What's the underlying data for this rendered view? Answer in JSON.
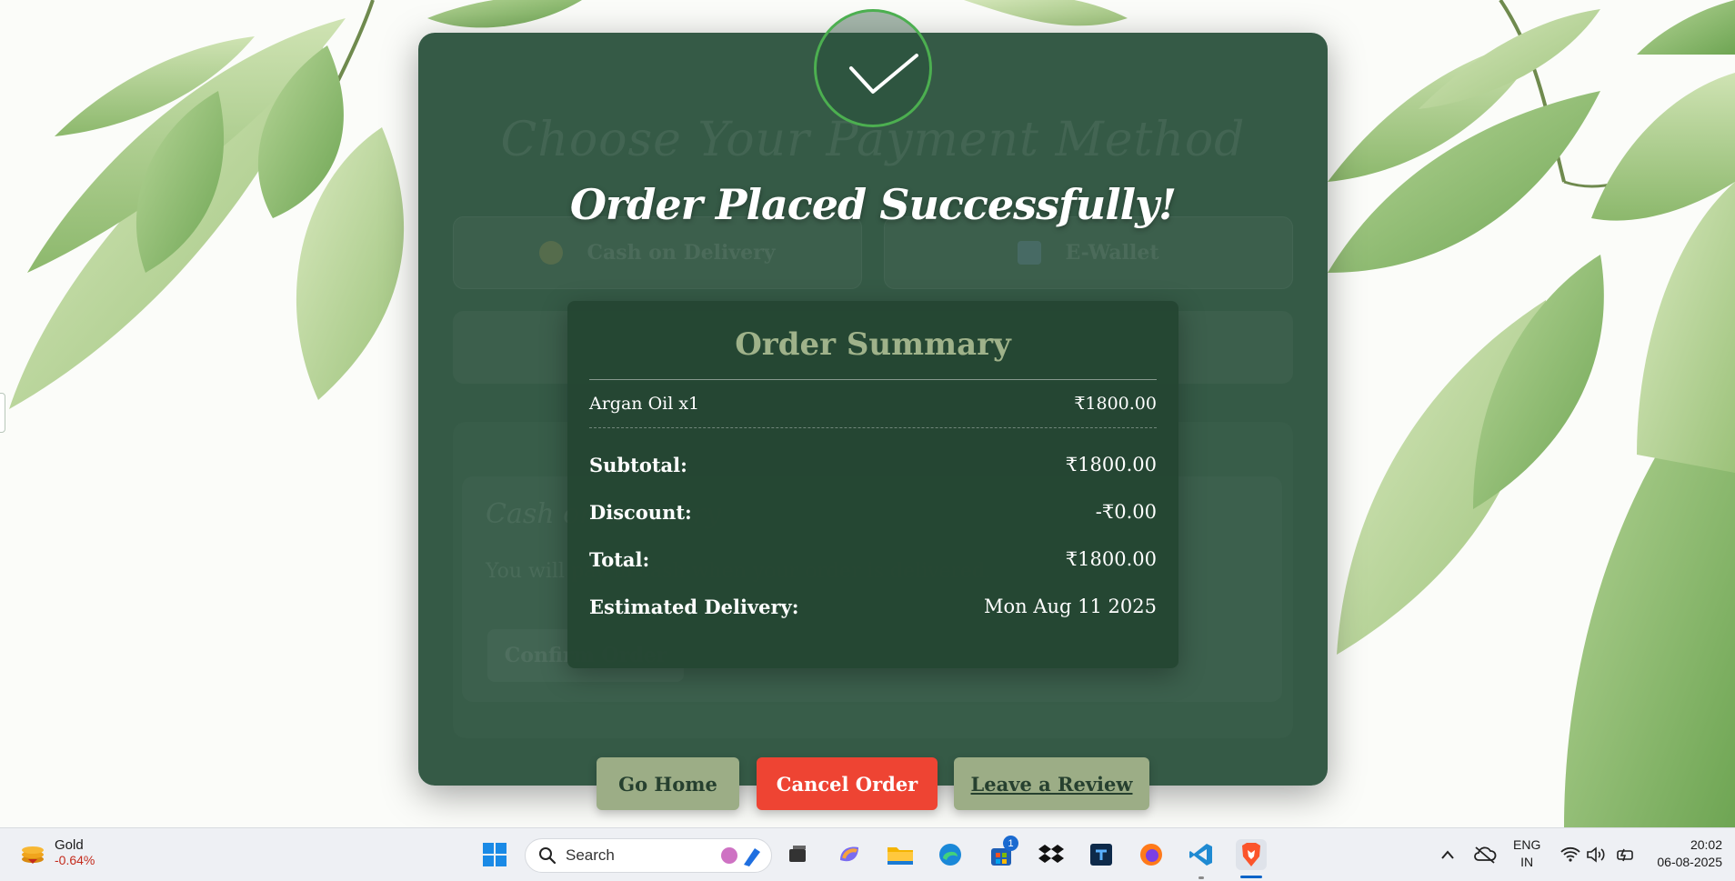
{
  "page": {
    "ghost_title": "Choose Your Payment Method",
    "payment_options": [
      "Cash on Delivery",
      "E-Wallet"
    ],
    "ghost_section_title": "Cash on Delivery",
    "ghost_section_text": "You will pay in cash when your order is delivered.",
    "ghost_confirm_label": "Confirm Order"
  },
  "success": {
    "title": "Order Placed Successfully!"
  },
  "summary": {
    "title": "Order Summary",
    "items": [
      {
        "name": "Argan Oil x1",
        "price": "₹1800.00"
      }
    ],
    "subtotal_label": "Subtotal:",
    "subtotal": "₹1800.00",
    "discount_label": "Discount:",
    "discount": "-₹0.00",
    "total_label": "Total:",
    "total": "₹1800.00",
    "delivery_label": "Estimated Delivery:",
    "delivery": "Mon Aug 11 2025"
  },
  "buttons": {
    "home": "Go Home",
    "cancel": "Cancel Order",
    "review": "Leave a Review"
  },
  "colors": {
    "accent": "#4caf50",
    "card": "#264d38",
    "cancel": "#ee4433",
    "sage": "#9cad86"
  },
  "taskbar": {
    "widget_name": "Gold",
    "widget_change": "-0.64%",
    "search_placeholder": "Search",
    "store_badge": "1",
    "lang_line1": "ENG",
    "lang_line2": "IN",
    "time": "20:02",
    "date": "06-08-2025",
    "apps": [
      "start-icon",
      "task-view-icon",
      "copilot-icon",
      "file-explorer-icon",
      "edge-icon",
      "store-icon",
      "dropbox-icon",
      "terminal-icon",
      "firefox-icon",
      "vscode-icon",
      "brave-icon"
    ]
  }
}
